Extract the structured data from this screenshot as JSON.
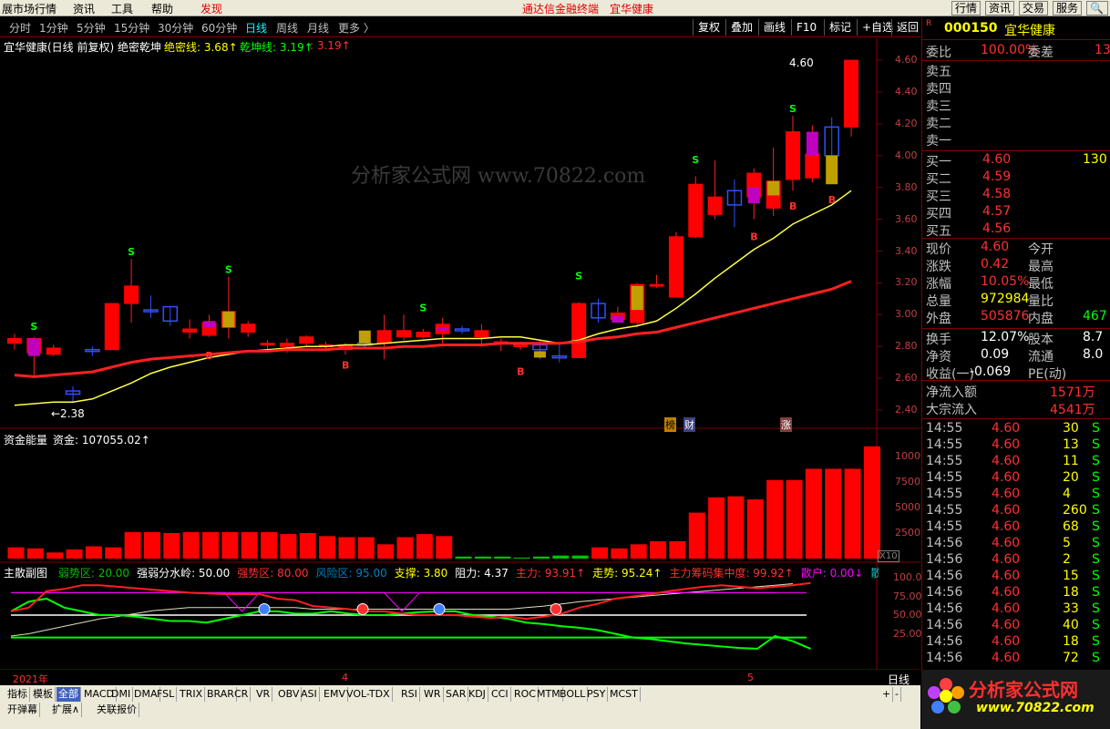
{
  "menubar": {
    "items": [
      "展市场行情",
      "资讯",
      "工具",
      "帮助",
      "发现"
    ],
    "center_title": "通达信金融终端",
    "stock_title": "宜华健康",
    "right_buttons": [
      "行情",
      "资讯",
      "交易",
      "服务"
    ]
  },
  "periodbar": {
    "periods": [
      "分时",
      "1分钟",
      "5分钟",
      "15分钟",
      "30分钟",
      "60分钟",
      "日线",
      "周线",
      "月线",
      "更多 〉"
    ],
    "selected": "日线",
    "right_buttons": [
      "复权",
      "叠加",
      "画线",
      "F10",
      "标记",
      "+自选",
      "返回"
    ]
  },
  "main_header": {
    "title": "宜华健康(日线 前复权) 绝密乾坤",
    "line1_label": "绝密线: 3.68↑",
    "line2_label": "乾坤线: 3.19↑",
    "line3_label": ": 3.19↑"
  },
  "main_chart": {
    "high_label": "4.60",
    "low_label": "←2.38",
    "y_ticks": [
      "4.60",
      "4.40",
      "4.20",
      "4.00",
      "3.80",
      "3.60",
      "3.40",
      "3.20",
      "3.00",
      "2.80",
      "2.60",
      "2.40"
    ],
    "badges": [
      "榜",
      "财",
      "涨"
    ],
    "watermark": "分析家公式网 www.70822.com"
  },
  "fund_header": {
    "title": "资金能量",
    "value_label": "资金: 107055.02↑",
    "y_ticks": [
      "10000",
      "7500",
      "5000",
      "2500"
    ],
    "scale": "X10"
  },
  "sub_header": {
    "title": "主散副图",
    "items": [
      {
        "t": "弱势区: 20.00",
        "c": "#00c000"
      },
      {
        "t": "强弱分水岭: 50.00",
        "c": "#ffffff"
      },
      {
        "t": "强势区: 80.00",
        "c": "#ff3030"
      },
      {
        "t": "风险区: 95.00",
        "c": "#0080c0"
      },
      {
        "t": "支撑: 3.80",
        "c": "#ffff00"
      },
      {
        "t": "阻力: 4.37",
        "c": "#ffffff"
      },
      {
        "t": "主力: 93.91↑",
        "c": "#ff3030"
      },
      {
        "t": "走势: 95.24↑",
        "c": "#ffff00"
      },
      {
        "t": "主力筹码集中度: 99.92↑",
        "c": "#ff3030"
      },
      {
        "t": "散户: 0.00↓",
        "c": "#ff00ff"
      },
      {
        "t": "散户筹码集中度:",
        "c": "#00c0c0"
      }
    ],
    "y_ticks": [
      "100.0",
      "75.00",
      "50.00",
      "25.00"
    ]
  },
  "time_axis": {
    "labels": [
      "2021年",
      "4",
      "5"
    ],
    "period": "日线"
  },
  "bottombar": {
    "tabs": [
      "指标",
      "模板",
      "全部",
      "MACD",
      "DMI",
      "DMA",
      "FSL",
      "TRIX",
      "BRAR",
      "CR",
      "VR",
      "OBV",
      "ASI",
      "EMV",
      "VOL-TDX",
      "RSI",
      "WR",
      "SAR",
      "KDJ",
      "CCI",
      "ROC",
      "MTM",
      "BOLL",
      "PSY",
      "MCST"
    ],
    "tabs2": [
      "开弹幕",
      "扩展∧",
      "关联报价"
    ]
  },
  "quote": {
    "code": "000150",
    "name": "宜华健康",
    "weibi_label": "委比",
    "weibi": "100.00%",
    "weicha_label": "委差",
    "weicha": "13",
    "sells": [
      {
        "l": "卖五"
      },
      {
        "l": "卖四"
      },
      {
        "l": "卖三"
      },
      {
        "l": "卖二"
      },
      {
        "l": "卖一"
      }
    ],
    "buys": [
      {
        "l": "买一",
        "p": "4.60",
        "v": "130"
      },
      {
        "l": "买二",
        "p": "4.59"
      },
      {
        "l": "买三",
        "p": "4.58"
      },
      {
        "l": "买四",
        "p": "4.57"
      },
      {
        "l": "买五",
        "p": "4.56"
      }
    ],
    "stats": [
      {
        "a": "现价",
        "av": "4.60",
        "b": "今开",
        "bv": ""
      },
      {
        "a": "涨跌",
        "av": "0.42",
        "b": "最高",
        "bv": ""
      },
      {
        "a": "涨幅",
        "av": "10.05%",
        "b": "最低",
        "bv": ""
      },
      {
        "a": "总量",
        "av": "972984",
        "b": "量比",
        "bv": ""
      },
      {
        "a": "外盘",
        "av": "505876",
        "b": "内盘",
        "bv": "467"
      }
    ],
    "stats2": [
      {
        "a": "换手",
        "av": "12.07%",
        "b": "股本",
        "bv": "8.7"
      },
      {
        "a": "净资",
        "av": "0.09",
        "b": "流通",
        "bv": "8.0"
      },
      {
        "a": "收益(一)",
        "av": "-0.069",
        "b": "PE(动)",
        "bv": ""
      }
    ],
    "flow": [
      {
        "a": "净流入额",
        "v": "1571万"
      },
      {
        "a": "大宗流入",
        "v": "4541万"
      }
    ],
    "ticks": [
      [
        "14:55",
        "4.60",
        "30",
        "S"
      ],
      [
        "14:55",
        "4.60",
        "13",
        "S"
      ],
      [
        "14:55",
        "4.60",
        "11",
        "S"
      ],
      [
        "14:55",
        "4.60",
        "20",
        "S"
      ],
      [
        "14:55",
        "4.60",
        "4",
        "S"
      ],
      [
        "14:55",
        "4.60",
        "260",
        "S"
      ],
      [
        "14:55",
        "4.60",
        "68",
        "S"
      ],
      [
        "14:56",
        "4.60",
        "5",
        "S"
      ],
      [
        "14:56",
        "4.60",
        "2",
        "S"
      ],
      [
        "14:56",
        "4.60",
        "15",
        "S"
      ],
      [
        "14:56",
        "4.60",
        "18",
        "S"
      ],
      [
        "14:56",
        "4.60",
        "33",
        "S"
      ],
      [
        "14:56",
        "4.60",
        "40",
        "S"
      ],
      [
        "14:56",
        "4.60",
        "18",
        "S"
      ],
      [
        "14:56",
        "4.60",
        "72",
        "S"
      ]
    ]
  },
  "logo": {
    "text": "分析家公式网",
    "url": "www.70822.com"
  },
  "candles": [
    [
      2.82,
      2.85,
      2.88,
      2.78
    ],
    [
      2.76,
      2.85,
      2.86,
      2.62
    ],
    [
      2.75,
      2.79,
      2.81,
      2.74
    ],
    [
      2.52,
      2.5,
      2.55,
      2.45
    ],
    [
      2.78,
      2.77,
      2.8,
      2.74
    ],
    [
      2.78,
      3.07,
      3.07,
      2.78
    ],
    [
      3.07,
      3.18,
      3.35,
      2.95
    ],
    [
      3.03,
      3.02,
      3.12,
      2.98
    ],
    [
      3.05,
      2.96,
      3.05,
      2.93
    ],
    [
      2.89,
      2.91,
      2.97,
      2.85
    ],
    [
      2.87,
      2.95,
      3.0,
      2.86
    ],
    [
      2.92,
      3.02,
      3.24,
      2.85
    ],
    [
      2.89,
      2.94,
      2.96,
      2.86
    ],
    [
      2.82,
      2.82,
      2.84,
      2.78
    ],
    [
      2.8,
      2.82,
      2.85,
      2.76
    ],
    [
      2.82,
      2.86,
      2.87,
      2.8
    ],
    [
      2.81,
      2.81,
      2.83,
      2.77
    ],
    [
      2.78,
      2.81,
      2.82,
      2.75
    ],
    [
      2.82,
      2.81,
      2.9,
      2.79
    ],
    [
      2.82,
      2.9,
      3.0,
      2.72
    ],
    [
      2.86,
      2.9,
      3.0,
      2.84
    ],
    [
      2.86,
      2.89,
      2.91,
      2.85
    ],
    [
      2.88,
      2.94,
      2.98,
      2.82
    ],
    [
      2.91,
      2.9,
      2.93,
      2.88
    ],
    [
      2.86,
      2.9,
      2.94,
      2.8
    ],
    [
      2.82,
      2.83,
      2.85,
      2.77
    ],
    [
      2.81,
      2.81,
      2.83,
      2.78
    ],
    [
      2.81,
      2.78,
      2.84,
      2.72
    ],
    [
      2.74,
      2.73,
      2.82,
      2.7
    ],
    [
      2.73,
      3.07,
      3.08,
      2.73
    ],
    [
      3.07,
      2.98,
      3.1,
      2.95
    ],
    [
      2.97,
      3.01,
      3.05,
      2.96
    ],
    [
      2.95,
      3.19,
      3.2,
      2.92
    ],
    [
      3.18,
      3.19,
      3.25,
      3.17
    ],
    [
      3.11,
      3.49,
      3.52,
      3.11
    ],
    [
      3.49,
      3.82,
      3.87,
      3.48
    ],
    [
      3.63,
      3.74,
      3.97,
      3.6
    ],
    [
      3.78,
      3.69,
      3.85,
      3.55
    ],
    [
      3.74,
      3.89,
      3.92,
      3.6
    ],
    [
      3.67,
      3.84,
      4.05,
      3.62
    ],
    [
      3.85,
      4.15,
      4.25,
      3.78
    ],
    [
      3.86,
      4.01,
      4.19,
      3.83
    ],
    [
      4.18,
      4.0,
      4.24,
      3.85
    ],
    [
      4.18,
      4.6,
      4.6,
      4.12
    ]
  ],
  "ma1": [
    2.43,
    2.44,
    2.45,
    2.45,
    2.47,
    2.52,
    2.57,
    2.63,
    2.67,
    2.7,
    2.73,
    2.75,
    2.77,
    2.78,
    2.79,
    2.8,
    2.8,
    2.81,
    2.81,
    2.82,
    2.83,
    2.84,
    2.85,
    2.85,
    2.85,
    2.86,
    2.86,
    2.84,
    2.82,
    2.84,
    2.88,
    2.91,
    2.93,
    2.96,
    3.04,
    3.13,
    3.23,
    3.32,
    3.41,
    3.48,
    3.57,
    3.63,
    3.69,
    3.78
  ],
  "ma2": [
    2.62,
    2.61,
    2.62,
    2.63,
    2.64,
    2.67,
    2.7,
    2.72,
    2.73,
    2.74,
    2.75,
    2.76,
    2.77,
    2.77,
    2.78,
    2.78,
    2.78,
    2.79,
    2.79,
    2.79,
    2.8,
    2.8,
    2.81,
    2.81,
    2.81,
    2.82,
    2.82,
    2.82,
    2.82,
    2.83,
    2.85,
    2.86,
    2.88,
    2.89,
    2.92,
    2.95,
    2.98,
    3.01,
    3.04,
    3.07,
    3.1,
    3.13,
    3.16,
    3.21
  ],
  "funds": [
    1100,
    1000,
    600,
    900,
    1200,
    1100,
    2600,
    2600,
    2500,
    2600,
    2600,
    2600,
    2600,
    2600,
    2400,
    2500,
    2200,
    2100,
    2100,
    1400,
    2100,
    2400,
    2200,
    200,
    200,
    200,
    100,
    200,
    300,
    300,
    1100,
    1000,
    1400,
    1700,
    1700,
    4500,
    6000,
    6100,
    5800,
    7700,
    7700,
    8800,
    8800,
    8800,
    11000
  ],
  "fund_colors": [
    "red",
    "red",
    "red",
    "red",
    "red",
    "red",
    "red",
    "red",
    "red",
    "red",
    "red",
    "red",
    "red",
    "red",
    "red",
    "red",
    "red",
    "red",
    "red",
    "red",
    "red",
    "red",
    "red",
    "green",
    "green",
    "green",
    "green",
    "green",
    "green",
    "green",
    "red",
    "red",
    "red",
    "red",
    "red",
    "red",
    "red",
    "red",
    "red",
    "red",
    "red",
    "red",
    "red",
    "red",
    "red"
  ]
}
